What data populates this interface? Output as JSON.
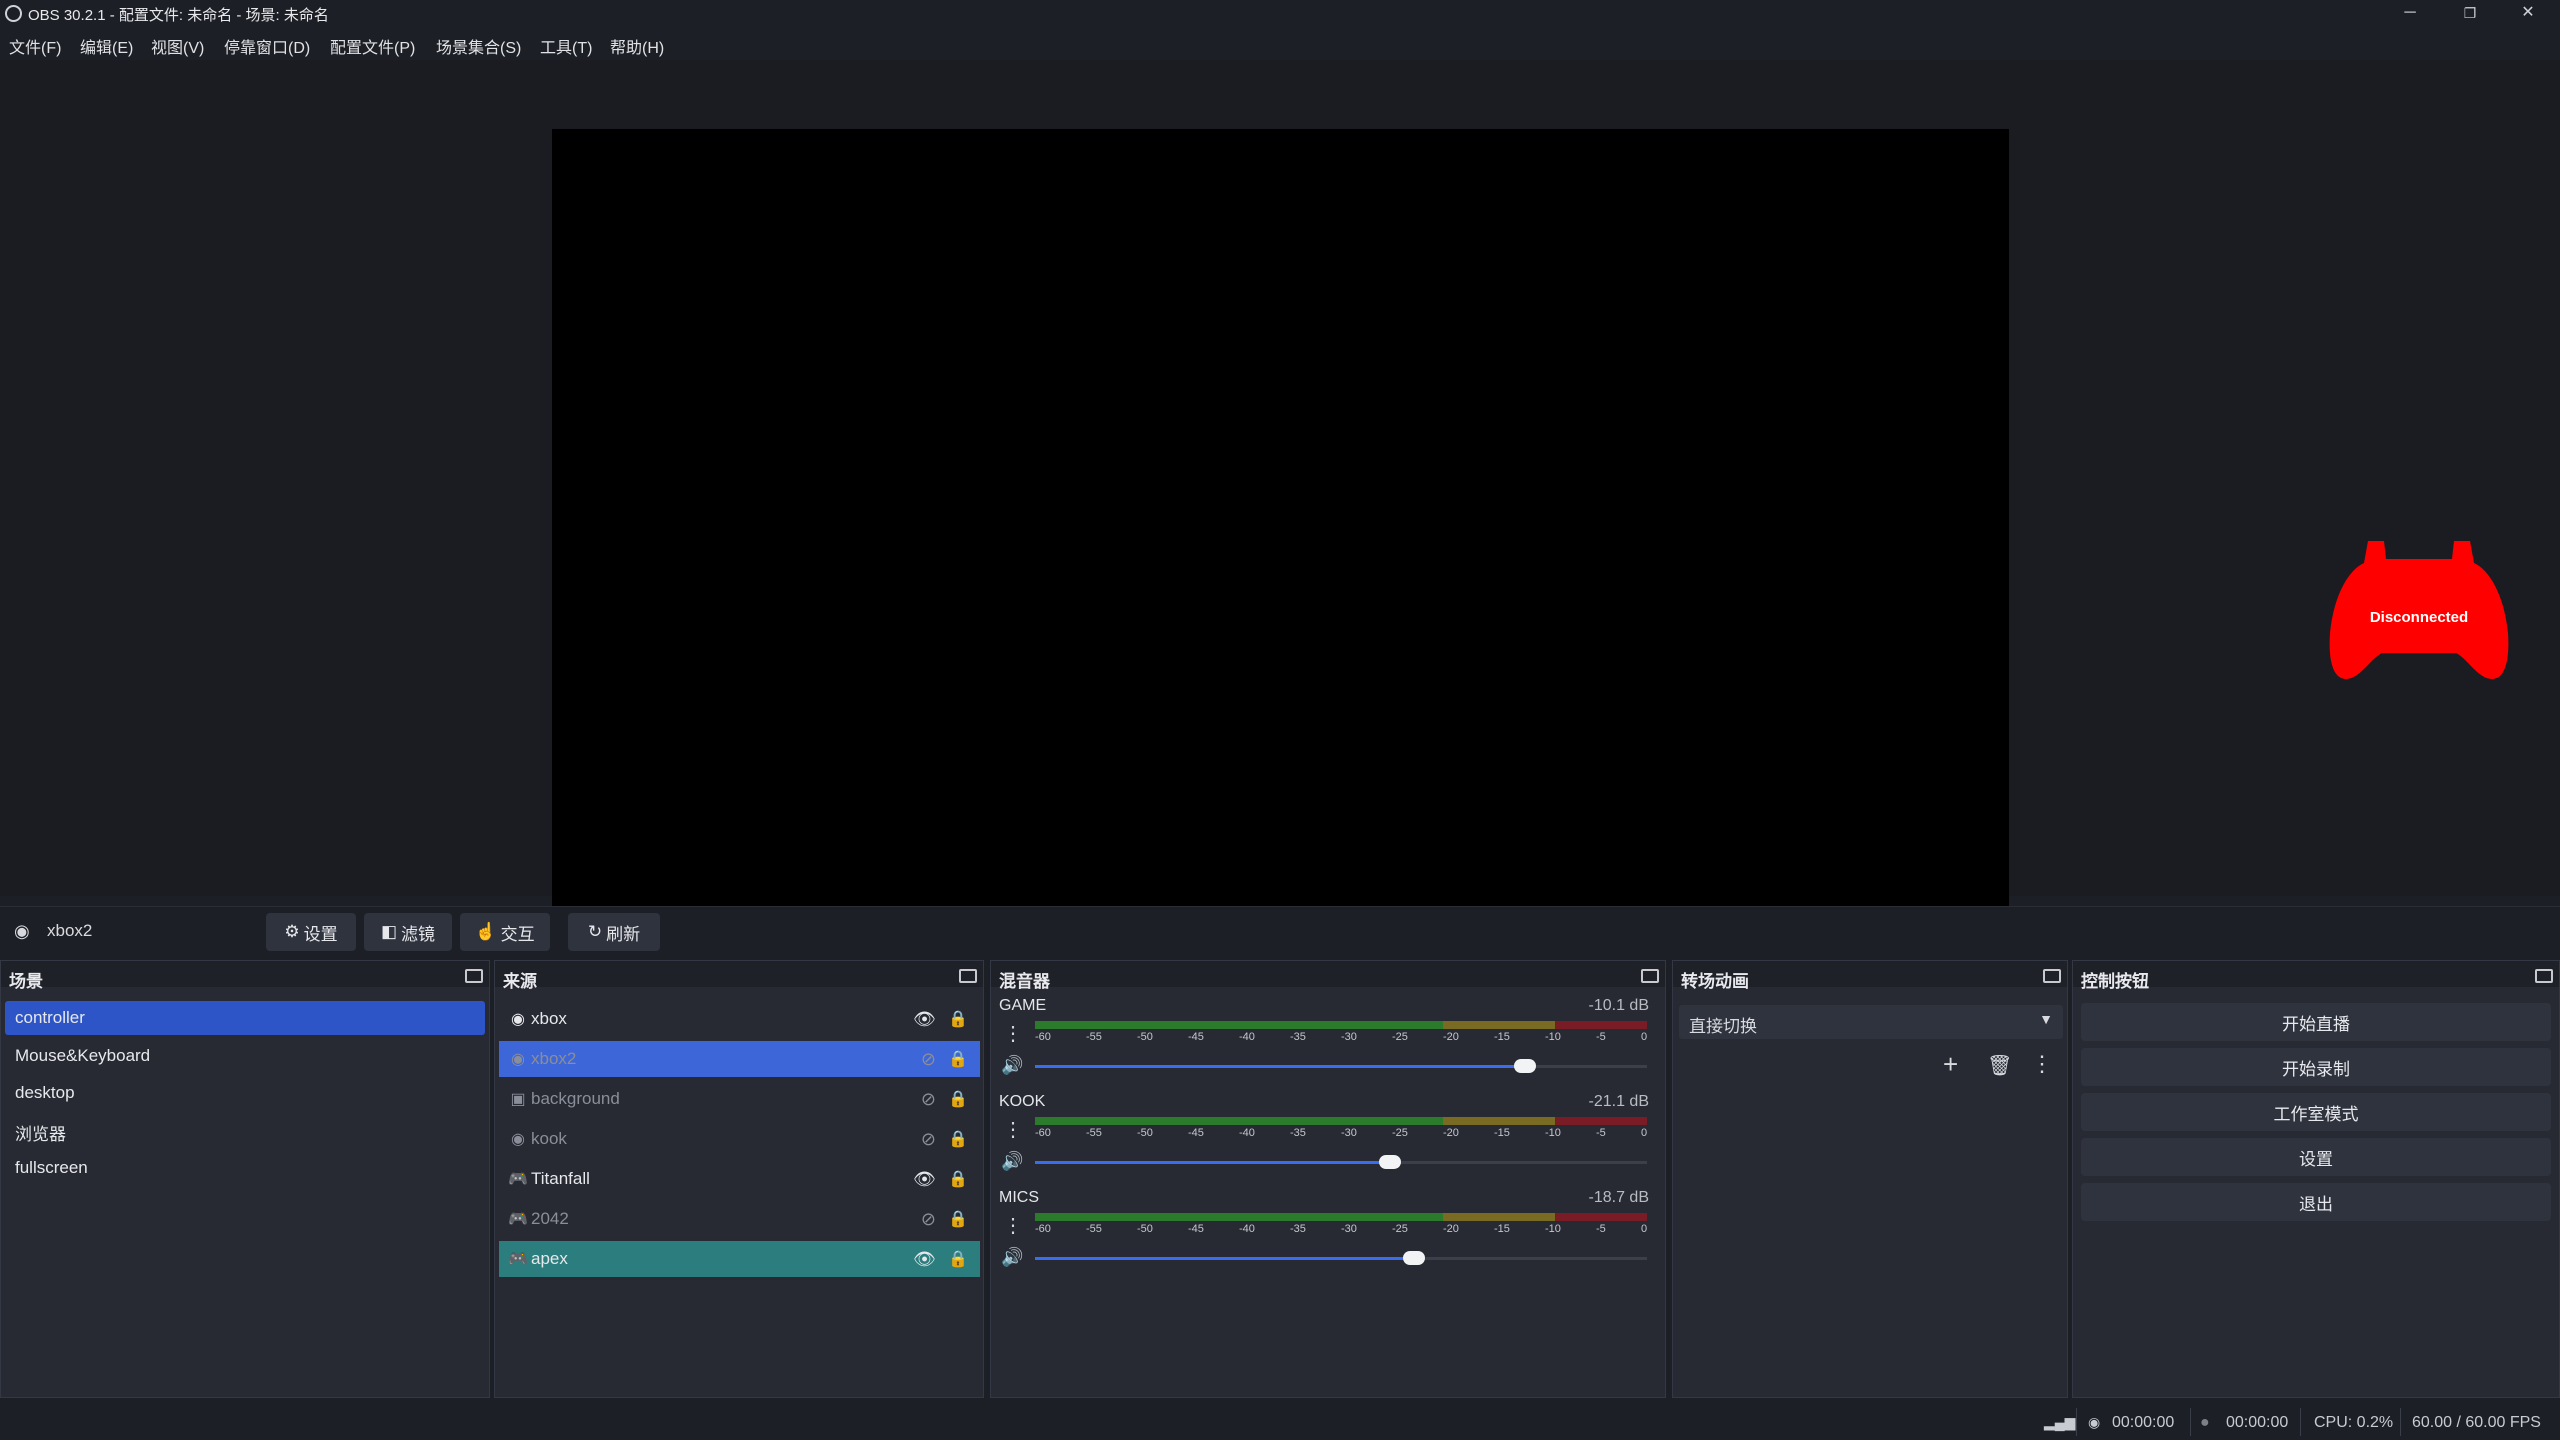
{
  "window": {
    "title": "OBS 30.2.1 - 配置文件: 未命名 - 场景: 未命名",
    "minimize": "─",
    "restore": "❐",
    "close": "✕"
  },
  "menu": [
    "文件(F)",
    "编辑(E)",
    "视图(V)",
    "停靠窗口(D)",
    "配置文件(P)",
    "场景集合(S)",
    "工具(T)",
    "帮助(H)"
  ],
  "preview": {
    "overlay_text": "Disconnected",
    "overlay_color": "#ff0000"
  },
  "source_toolbar": {
    "source_name": "xbox2",
    "settings": "设置",
    "filters": "滤镜",
    "interact": "交互",
    "refresh": "刷新"
  },
  "scenes": {
    "title": "场景",
    "items": [
      "controller",
      "Mouse&Keyboard",
      "desktop",
      "浏览器",
      "fullscreen"
    ],
    "selected": "controller"
  },
  "sources": {
    "title": "来源",
    "items": [
      {
        "name": "xbox",
        "icon": "browser-icon",
        "visible": true
      },
      {
        "name": "xbox2",
        "icon": "browser-icon",
        "visible": false
      },
      {
        "name": "background",
        "icon": "image-icon",
        "visible": false
      },
      {
        "name": "kook",
        "icon": "browser-icon",
        "visible": false
      },
      {
        "name": "Titanfall",
        "icon": "gamepad-icon",
        "visible": true
      },
      {
        "name": "2042",
        "icon": "gamepad-icon",
        "visible": false
      },
      {
        "name": "apex",
        "icon": "gamepad-icon",
        "visible": true
      }
    ]
  },
  "mixer": {
    "title": "混音器",
    "ticks": [
      "-60",
      "-55",
      "-50",
      "-45",
      "-40",
      "-35",
      "-30",
      "-25",
      "-20",
      "-15",
      "-10",
      "-5",
      "0"
    ],
    "channels": [
      {
        "name": "GAME",
        "db": "-10.1 dB",
        "volume": 0.8
      },
      {
        "name": "KOOK",
        "db": "-21.1 dB",
        "volume": 0.58
      },
      {
        "name": "MICS",
        "db": "-18.7 dB",
        "volume": 0.62
      }
    ]
  },
  "transitions": {
    "title": "转场动画",
    "selected": "直接切换"
  },
  "controls": {
    "title": "控制按钮",
    "buttons": [
      "开始直播",
      "开始录制",
      "工作室模式",
      "设置",
      "退出"
    ]
  },
  "status": {
    "stream_time": "00:00:00",
    "record_time": "00:00:00",
    "cpu": "CPU: 0.2%",
    "fps": "60.00 / 60.00 FPS"
  },
  "colors": {
    "selection": "#2d55c8",
    "teal_selection": "#2c7d7d",
    "accent": "#3b6cf0"
  }
}
